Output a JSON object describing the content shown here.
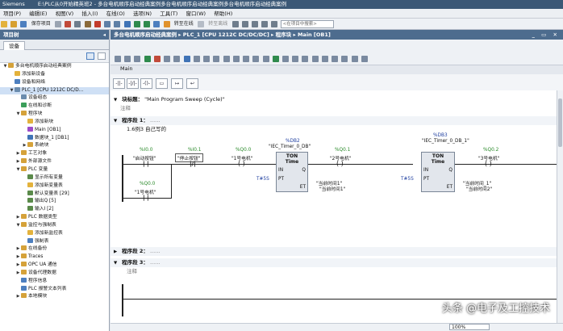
{
  "window": {
    "app": "Siemens",
    "path": "E:\\PLC从0开始精英班2 - 多台电机顺序启动经典案例多台电机顺序启动经典案例多台电机顺序启动经典案例"
  },
  "menu": [
    "项目(P)",
    "编辑(E)",
    "视图(V)",
    "插入(I)",
    "在线(O)",
    "选项(N)",
    "工具(T)",
    "窗口(W)",
    "帮助(H)"
  ],
  "toolbar": {
    "save_label": "保存项目",
    "go_online": "转至在线",
    "go_offline": "转至离线",
    "search_placeholder": "<在项目中搜索>"
  },
  "left_pane": {
    "title": "项目树",
    "tab": "设备",
    "tree": [
      {
        "label": "多台电机顺序启动经典案例",
        "indent": 0,
        "arrow": "▼",
        "icon": "#d5a23a"
      },
      {
        "label": "添加新设备",
        "indent": 1,
        "arrow": "",
        "icon": "#e3b23c"
      },
      {
        "label": "设备和网络",
        "indent": 1,
        "arrow": "",
        "icon": "#4d7fbf"
      },
      {
        "label": "PLC_1 [CPU 1212C DC/D...",
        "indent": 1,
        "arrow": "▼",
        "icon": "#6b8cae",
        "selected": true
      },
      {
        "label": "设备组态",
        "indent": 2,
        "arrow": "",
        "icon": "#6b8cae"
      },
      {
        "label": "在线和诊断",
        "indent": 2,
        "arrow": "",
        "icon": "#3b9e5a"
      },
      {
        "label": "程序块",
        "indent": 2,
        "arrow": "▼",
        "icon": "#d5a23a"
      },
      {
        "label": "添加新块",
        "indent": 3,
        "arrow": "",
        "icon": "#e3b23c"
      },
      {
        "label": "Main [OB1]",
        "indent": 3,
        "arrow": "",
        "icon": "#9c4cc8"
      },
      {
        "label": "数据块_1 [DB1]",
        "indent": 3,
        "arrow": "",
        "icon": "#3f73b6"
      },
      {
        "label": "系统块",
        "indent": 3,
        "arrow": "▶",
        "icon": "#d5a23a"
      },
      {
        "label": "工艺对象",
        "indent": 2,
        "arrow": "▶",
        "icon": "#d5a23a"
      },
      {
        "label": "外部源文件",
        "indent": 2,
        "arrow": "▶",
        "icon": "#d5a23a"
      },
      {
        "label": "PLC 变量",
        "indent": 2,
        "arrow": "▼",
        "icon": "#d5a23a"
      },
      {
        "label": "显示所有变量",
        "indent": 3,
        "arrow": "",
        "icon": "#5a8a4a"
      },
      {
        "label": "添加新变量表",
        "indent": 3,
        "arrow": "",
        "icon": "#e3b23c"
      },
      {
        "label": "默认变量表 [29]",
        "indent": 3,
        "arrow": "",
        "icon": "#5a8a4a"
      },
      {
        "label": "输出Q [5]",
        "indent": 3,
        "arrow": "",
        "icon": "#5a8a4a"
      },
      {
        "label": "输入I [2]",
        "indent": 3,
        "arrow": "",
        "icon": "#5a8a4a"
      },
      {
        "label": "PLC 数据类型",
        "indent": 2,
        "arrow": "▶",
        "icon": "#d5a23a"
      },
      {
        "label": "监控与强制表",
        "indent": 2,
        "arrow": "▼",
        "icon": "#d5a23a"
      },
      {
        "label": "添加新监控表",
        "indent": 3,
        "arrow": "",
        "icon": "#e3b23c"
      },
      {
        "label": "强制表",
        "indent": 3,
        "arrow": "",
        "icon": "#4d7fbf"
      },
      {
        "label": "在线备份",
        "indent": 2,
        "arrow": "▶",
        "icon": "#d5a23a"
      },
      {
        "label": "Traces",
        "indent": 2,
        "arrow": "▶",
        "icon": "#d5a23a"
      },
      {
        "label": "OPC UA 通信",
        "indent": 2,
        "arrow": "▶",
        "icon": "#d5a23a"
      },
      {
        "label": "设备代理数据",
        "indent": 2,
        "arrow": "▶",
        "icon": "#d5a23a"
      },
      {
        "label": "程序信息",
        "indent": 2,
        "arrow": "",
        "icon": "#4d7fbf"
      },
      {
        "label": "PLC 报警文本列表",
        "indent": 2,
        "arrow": "",
        "icon": "#4d7fbf"
      },
      {
        "label": "本地模块",
        "indent": 2,
        "arrow": "▶",
        "icon": "#d5a23a"
      }
    ]
  },
  "editor": {
    "breadcrumb": "多台电机顺序启动经典案例 ▸ PLC_1 [CPU 1212C DC/DC/DC] ▸ 程序块 ▸ Main [OB1]",
    "tab": "Main",
    "block_title_label": "块标题：",
    "block_title_value": "\"Main Program Sweep (Cycle)\"",
    "block_comment": "注释",
    "seg1_label": "程序段 1：",
    "seg1_dots": "......",
    "seg1_comment": "1.6例3   自己写的",
    "seg2_label": "程序段 2：",
    "seg2_dots": "......",
    "seg3_label": "程序段 3：",
    "seg3_dots": "......",
    "seg3_comment": "注释"
  },
  "ladder": {
    "c1_addr": "%I0.0",
    "c1_name": "\"启动按钮\"",
    "c2_addr": "%I0.1",
    "c2_name": "\"停止按钮\"",
    "coil1_addr": "%Q0.0",
    "coil1_name": "\"1号电机\"",
    "db2_addr": "%DB2",
    "db2_name": "\"IEC_Timer_0_DB\"",
    "ton1_title": "TON",
    "ton1_sub": "Time",
    "ton1_in": "IN",
    "ton1_q": "Q",
    "ton1_pt": "PT",
    "ton1_et": "ET",
    "ton1_pt_val": "T#5S",
    "ton1_et_val1": "\"当前时间1\"",
    "ton1_et_val2": "\"当前时间1\"",
    "coil2_addr": "%Q0.1",
    "coil2_name": "\"2号电机\"",
    "db3_addr": "%DB3",
    "db3_name": "\"IEC_Timer_0_DB_1\"",
    "ton2_title": "TON",
    "ton2_sub": "Time",
    "ton2_in": "IN",
    "ton2_q": "Q",
    "ton2_pt": "PT",
    "ton2_et": "ET",
    "ton2_pt_val": "T#5S",
    "ton2_et_val1": "\"当前时间_1\"",
    "ton2_et_val2": "\"当前时间2\"",
    "coil3_addr": "%Q0.2",
    "coil3_name": "\"3号电机\"",
    "seal_addr": "%Q0.0",
    "seal_name": "\"1号电机\""
  },
  "status": {
    "zoom": "100%"
  },
  "watermark": "头条 @电子及工控技术"
}
